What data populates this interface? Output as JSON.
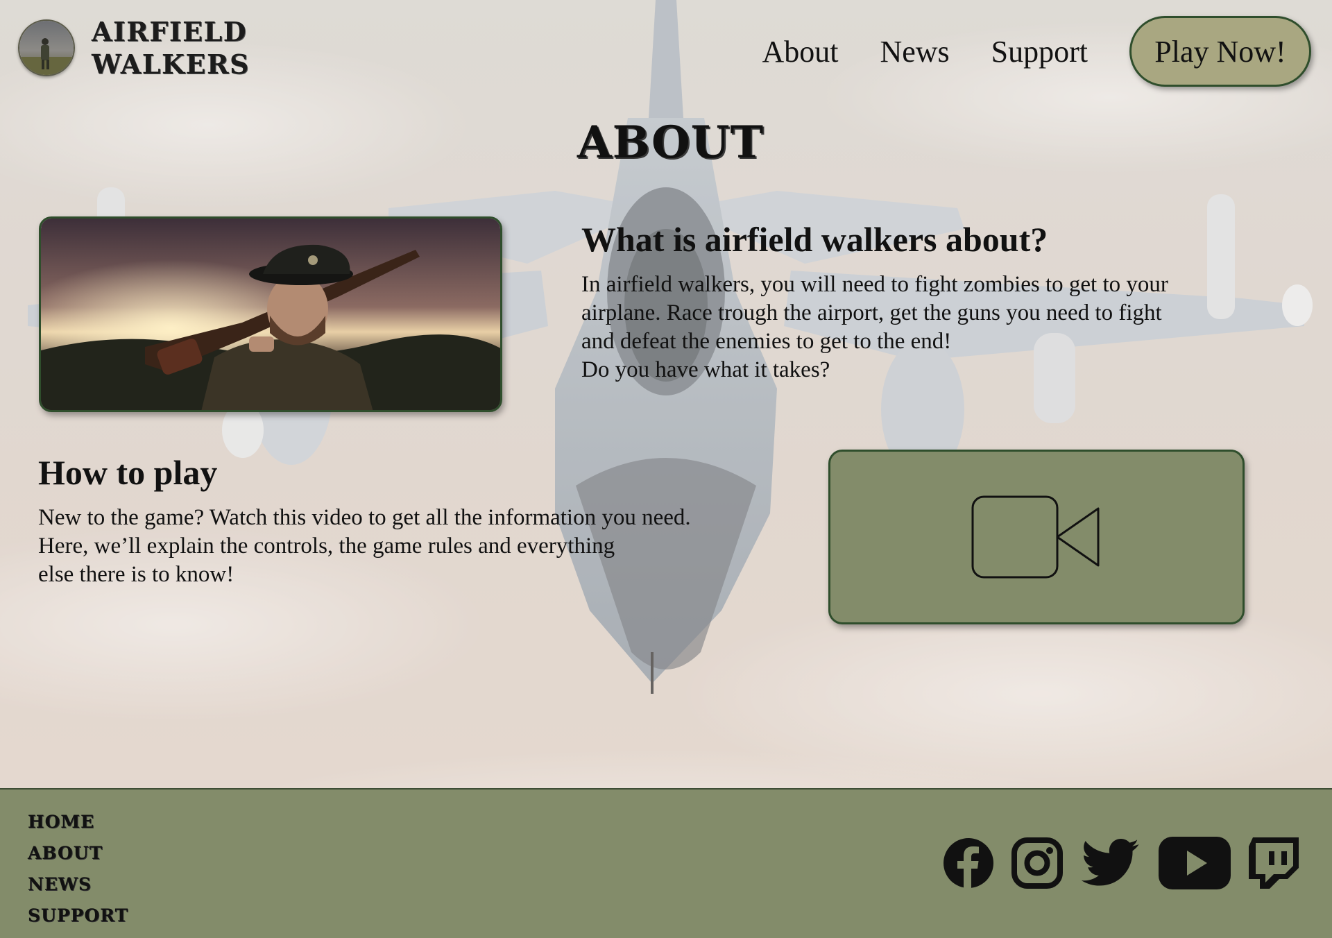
{
  "brand": {
    "name_line1": "AIRFIELD",
    "name_line2": "WALKERS",
    "logo_icon": "soldier-portrait-icon"
  },
  "nav": {
    "items": [
      "About",
      "News",
      "Support"
    ],
    "cta": "Play Now!"
  },
  "page": {
    "title": "ABOUT"
  },
  "about": {
    "heading": "What is airfield walkers about?",
    "lines": [
      "In airfield walkers, you will need to fight zombies to get to your",
      "airplane. Race trough the airport, get the guns you need to fight",
      "and defeat the enemies to get to the end!",
      "Do you have what it takes?"
    ]
  },
  "howto": {
    "heading": "How to play",
    "lines": [
      "New to the game? Watch this video to get all the information you need.",
      "Here, we’ll explain the controls, the game rules and everything",
      "else there is to know!"
    ],
    "video_icon": "video-camera-icon"
  },
  "footer": {
    "links": [
      "HOME",
      "ABOUT",
      "NEWS",
      "SUPPORT"
    ],
    "social_icons": [
      "facebook-icon",
      "instagram-icon",
      "twitter-icon",
      "youtube-icon",
      "twitch-icon"
    ]
  },
  "colors": {
    "accent_olive": "#838c6a",
    "button_khaki": "#a9a781",
    "border_green": "#2f4e2c",
    "text": "#111111"
  }
}
